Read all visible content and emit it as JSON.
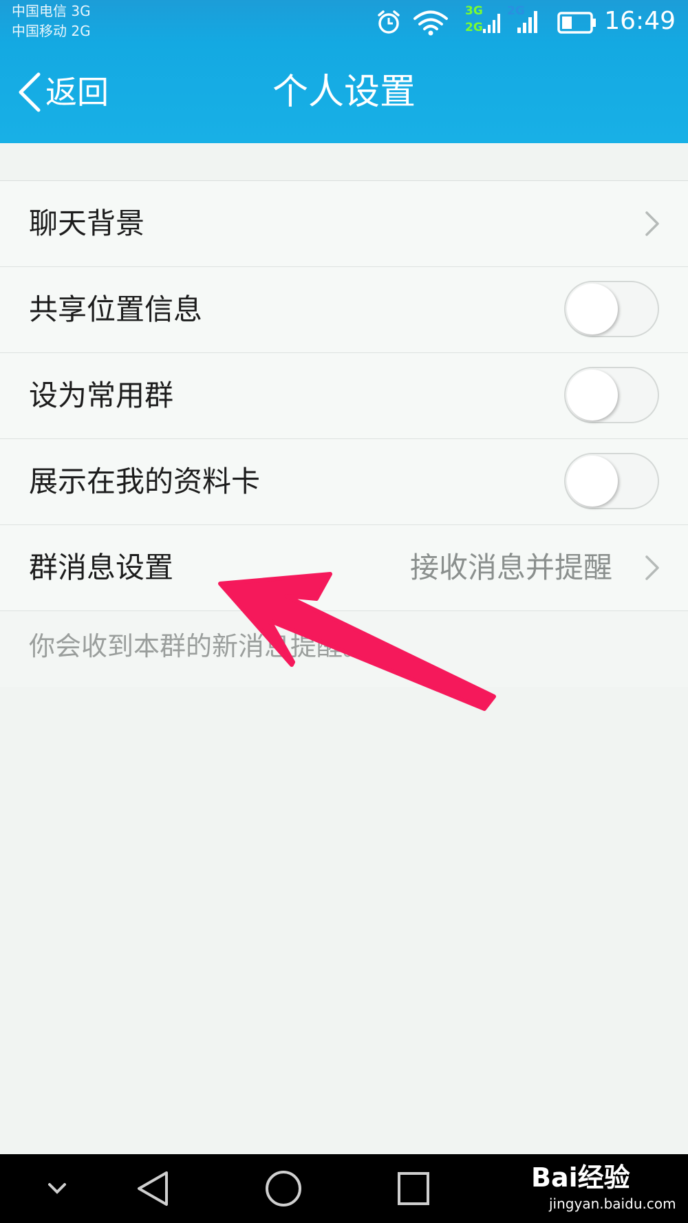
{
  "status_bar": {
    "carrier_1": "中国电信 3G",
    "carrier_2": "中国移动 2G",
    "net_3g": "3G",
    "net_2g_left": "2G",
    "net_2g_right": "2G",
    "time": "16:49",
    "icons": [
      "alarm-icon",
      "wifi-icon",
      "signal-icon",
      "battery-icon"
    ]
  },
  "header": {
    "back_label": "返回",
    "title": "个人设置",
    "accent_color": "#18b0e6"
  },
  "settings": {
    "items": [
      {
        "label": "聊天背景",
        "control": "chevron"
      },
      {
        "label": "共享位置信息",
        "control": "toggle",
        "on": false
      },
      {
        "label": "设为常用群",
        "control": "toggle",
        "on": false
      },
      {
        "label": "展示在我的资料卡",
        "control": "toggle",
        "on": false
      },
      {
        "label": "群消息设置",
        "value": "接收消息并提醒",
        "control": "chevron"
      }
    ],
    "hint": "你会收到本群的新消息提醒。"
  },
  "annotation": {
    "arrow_color": "#f5195b"
  },
  "system_nav": {
    "buttons": [
      "collapse-icon",
      "back-triangle-icon",
      "home-circle-icon",
      "recents-square-icon"
    ]
  },
  "watermark": {
    "logo_text": "Bai经验",
    "url": "jingyan.baidu.com"
  }
}
